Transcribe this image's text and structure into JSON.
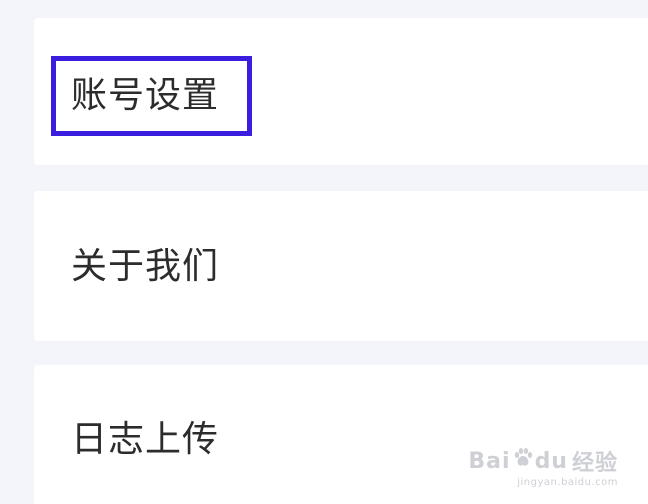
{
  "menu": {
    "items": [
      {
        "label": "账号设置"
      },
      {
        "label": "关于我们"
      },
      {
        "label": "日志上传"
      }
    ]
  },
  "colors": {
    "background": "#f3f5fa",
    "card": "#ffffff",
    "highlight": "#3a1ee0",
    "text": "#2c2c2c"
  },
  "watermark": {
    "logo_left": "Bai",
    "logo_right": "du",
    "logo_suffix": "经验",
    "url": "jingyan.baidu.com",
    "icon": "paw-icon"
  }
}
